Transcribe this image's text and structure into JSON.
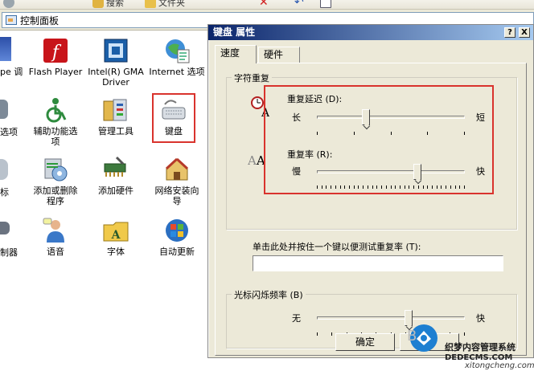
{
  "explorer": {
    "address": "控制面板",
    "toolbar": {
      "search_label": "搜索",
      "folders_label": "文件夹"
    }
  },
  "control_panel": {
    "edge_items": [
      {
        "label": "pe 调"
      },
      {
        "label": "选项"
      },
      {
        "label": "标"
      },
      {
        "label": "制器"
      }
    ],
    "items": [
      {
        "label": "Flash Player",
        "icon": "flash-player-icon"
      },
      {
        "label": "Intel(R) GMA\nDriver",
        "icon": "intel-gma-icon"
      },
      {
        "label": "Internet 选项",
        "icon": "internet-options-icon"
      },
      {
        "label": "辅助功能选\n项",
        "icon": "accessibility-icon"
      },
      {
        "label": "管理工具",
        "icon": "admin-tools-icon"
      },
      {
        "label": "键盘",
        "icon": "keyboard-icon"
      },
      {
        "label": "添加或删除\n程序",
        "icon": "add-remove-programs-icon"
      },
      {
        "label": "添加硬件",
        "icon": "add-hardware-icon"
      },
      {
        "label": "网络安装向\n导",
        "icon": "network-wizard-icon"
      },
      {
        "label": "语音",
        "icon": "speech-icon"
      },
      {
        "label": "字体",
        "icon": "fonts-icon"
      },
      {
        "label": "自动更新",
        "icon": "automatic-updates-icon"
      }
    ]
  },
  "dialog": {
    "title": "键盘 属性",
    "help_btn": "?",
    "close_btn": "X",
    "tabs": [
      {
        "label": "速度"
      },
      {
        "label": "硬件"
      }
    ],
    "char_repeat": {
      "legend": "字符重复",
      "delay_label": "重复延迟 (D):",
      "delay_left": "长",
      "delay_right": "短",
      "delay_value": 0.33,
      "rate_label": "重复率 (R):",
      "rate_left": "慢",
      "rate_right": "快",
      "rate_value": 0.68,
      "test_label": "单击此处并按住一个键以便测试重复率 (T):",
      "test_value": ""
    },
    "cursor_blink": {
      "legend": "光标闪烁频率 (B)",
      "left": "无",
      "right": "快",
      "value": 0.62
    },
    "buttons": {
      "ok": "确定"
    }
  },
  "watermark": {
    "text_latin": "B",
    "text_site": "织梦内容管理系统",
    "url": "DEDECMS.COM",
    "url2": "xitongcheng.com"
  },
  "colors": {
    "highlight_red": "#d9332d",
    "title_bar": "#0a246a",
    "dialog_bg": "#ece9d8"
  }
}
